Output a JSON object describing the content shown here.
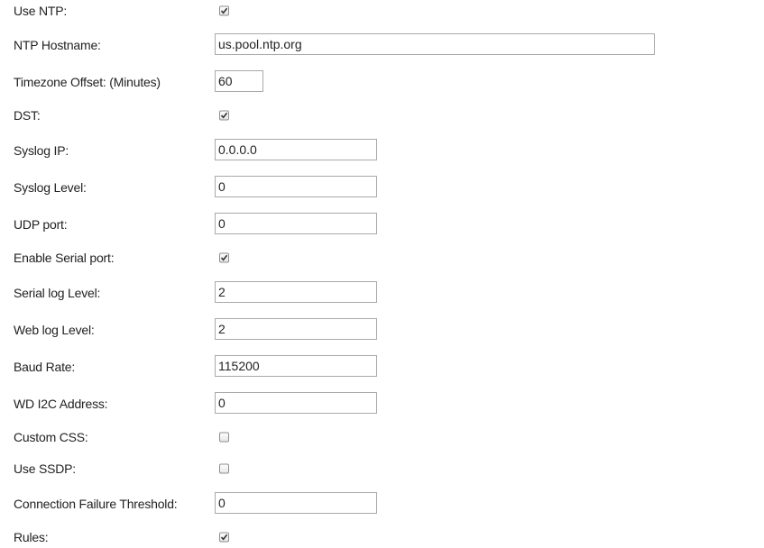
{
  "settings": [
    {
      "label": "Use NTP:",
      "type": "checkbox",
      "checked": true
    },
    {
      "label": "NTP Hostname:",
      "type": "text",
      "value": "us.pool.ntp.org"
    },
    {
      "label": "Timezone Offset: (Minutes)",
      "type": "text",
      "value": "60"
    },
    {
      "label": "DST:",
      "type": "checkbox",
      "checked": true
    },
    {
      "label": "Syslog IP:",
      "type": "text",
      "value": "0.0.0.0"
    },
    {
      "label": "Syslog Level:",
      "type": "text",
      "value": "0"
    },
    {
      "label": "UDP port:",
      "type": "text",
      "value": "0"
    },
    {
      "label": "Enable Serial port:",
      "type": "checkbox",
      "checked": true
    },
    {
      "label": "Serial log Level:",
      "type": "text",
      "value": "2"
    },
    {
      "label": "Web log Level:",
      "type": "text",
      "value": "2"
    },
    {
      "label": "Baud Rate:",
      "type": "text",
      "value": "115200"
    },
    {
      "label": "WD I2C Address:",
      "type": "text",
      "value": "0"
    },
    {
      "label": "Custom CSS:",
      "type": "checkbox",
      "checked": false
    },
    {
      "label": "Use SSDP:",
      "type": "checkbox",
      "checked": false
    },
    {
      "label": "Connection Failure Threshold:",
      "type": "text",
      "value": "0"
    },
    {
      "label": "Rules:",
      "type": "checkbox",
      "checked": true
    }
  ]
}
